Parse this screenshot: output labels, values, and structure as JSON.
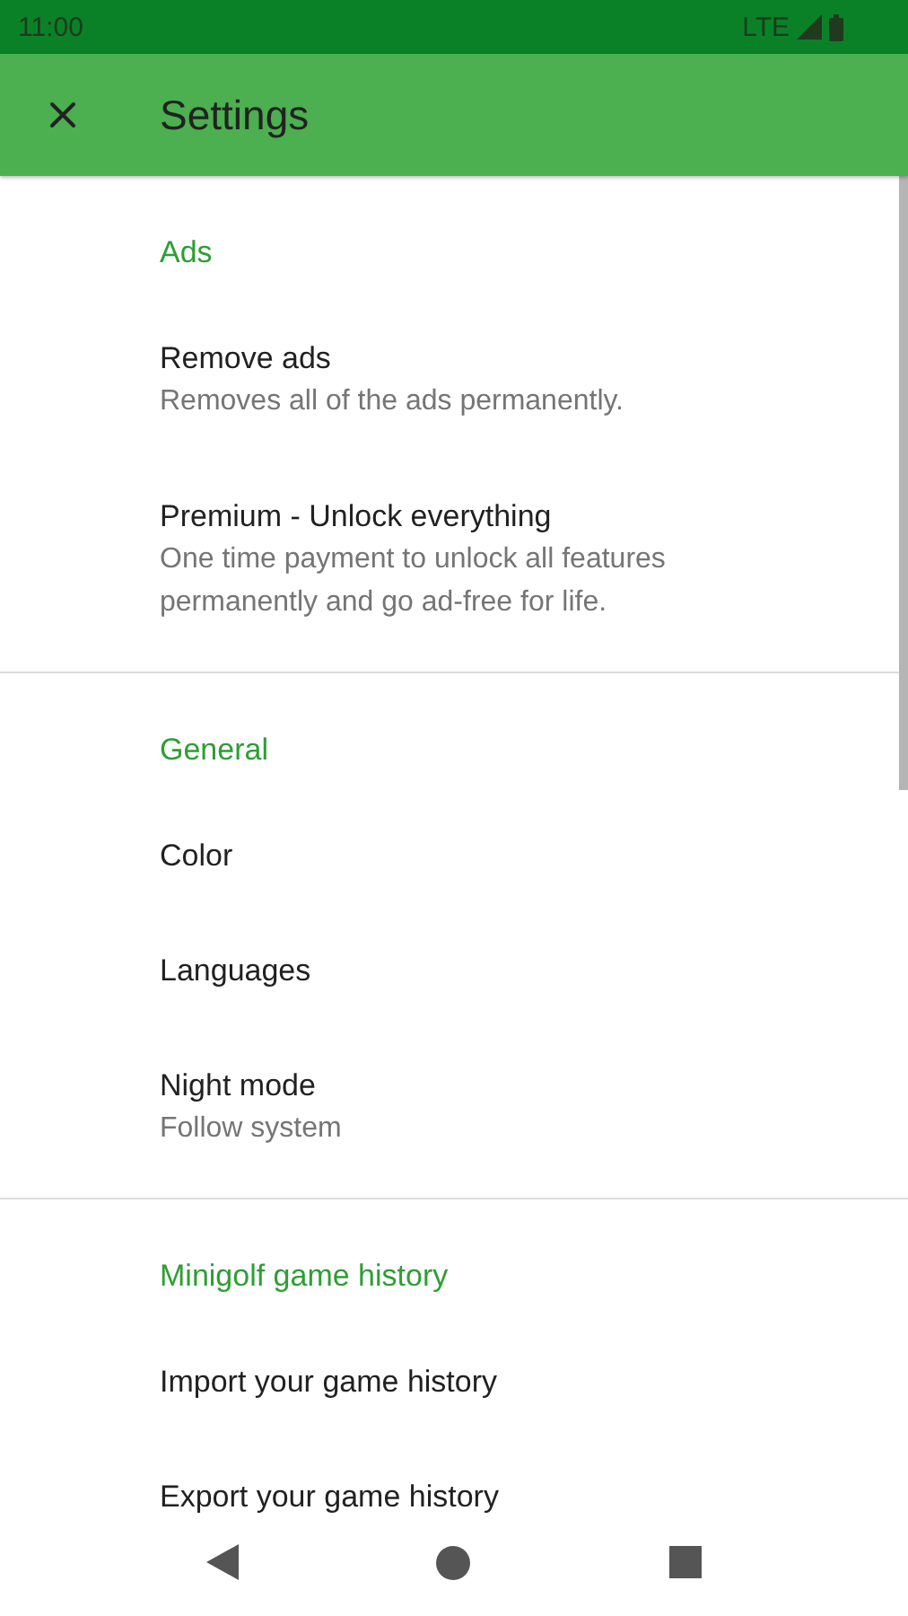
{
  "status_bar": {
    "time": "11:00",
    "network": "LTE"
  },
  "app_bar": {
    "title": "Settings"
  },
  "sections": [
    {
      "header": "Ads",
      "items": [
        {
          "title": "Remove ads",
          "subtitle": "Removes all of the ads permanently."
        },
        {
          "title": "Premium - Unlock everything",
          "subtitle": "One time payment to unlock all features permanently and go ad-free for life."
        }
      ]
    },
    {
      "header": "General",
      "items": [
        {
          "title": "Color"
        },
        {
          "title": "Languages"
        },
        {
          "title": "Night mode",
          "subtitle": "Follow system"
        }
      ]
    },
    {
      "header": "Minigolf game history",
      "items": [
        {
          "title": "Import your game history"
        },
        {
          "title": "Export your game history"
        }
      ]
    }
  ]
}
